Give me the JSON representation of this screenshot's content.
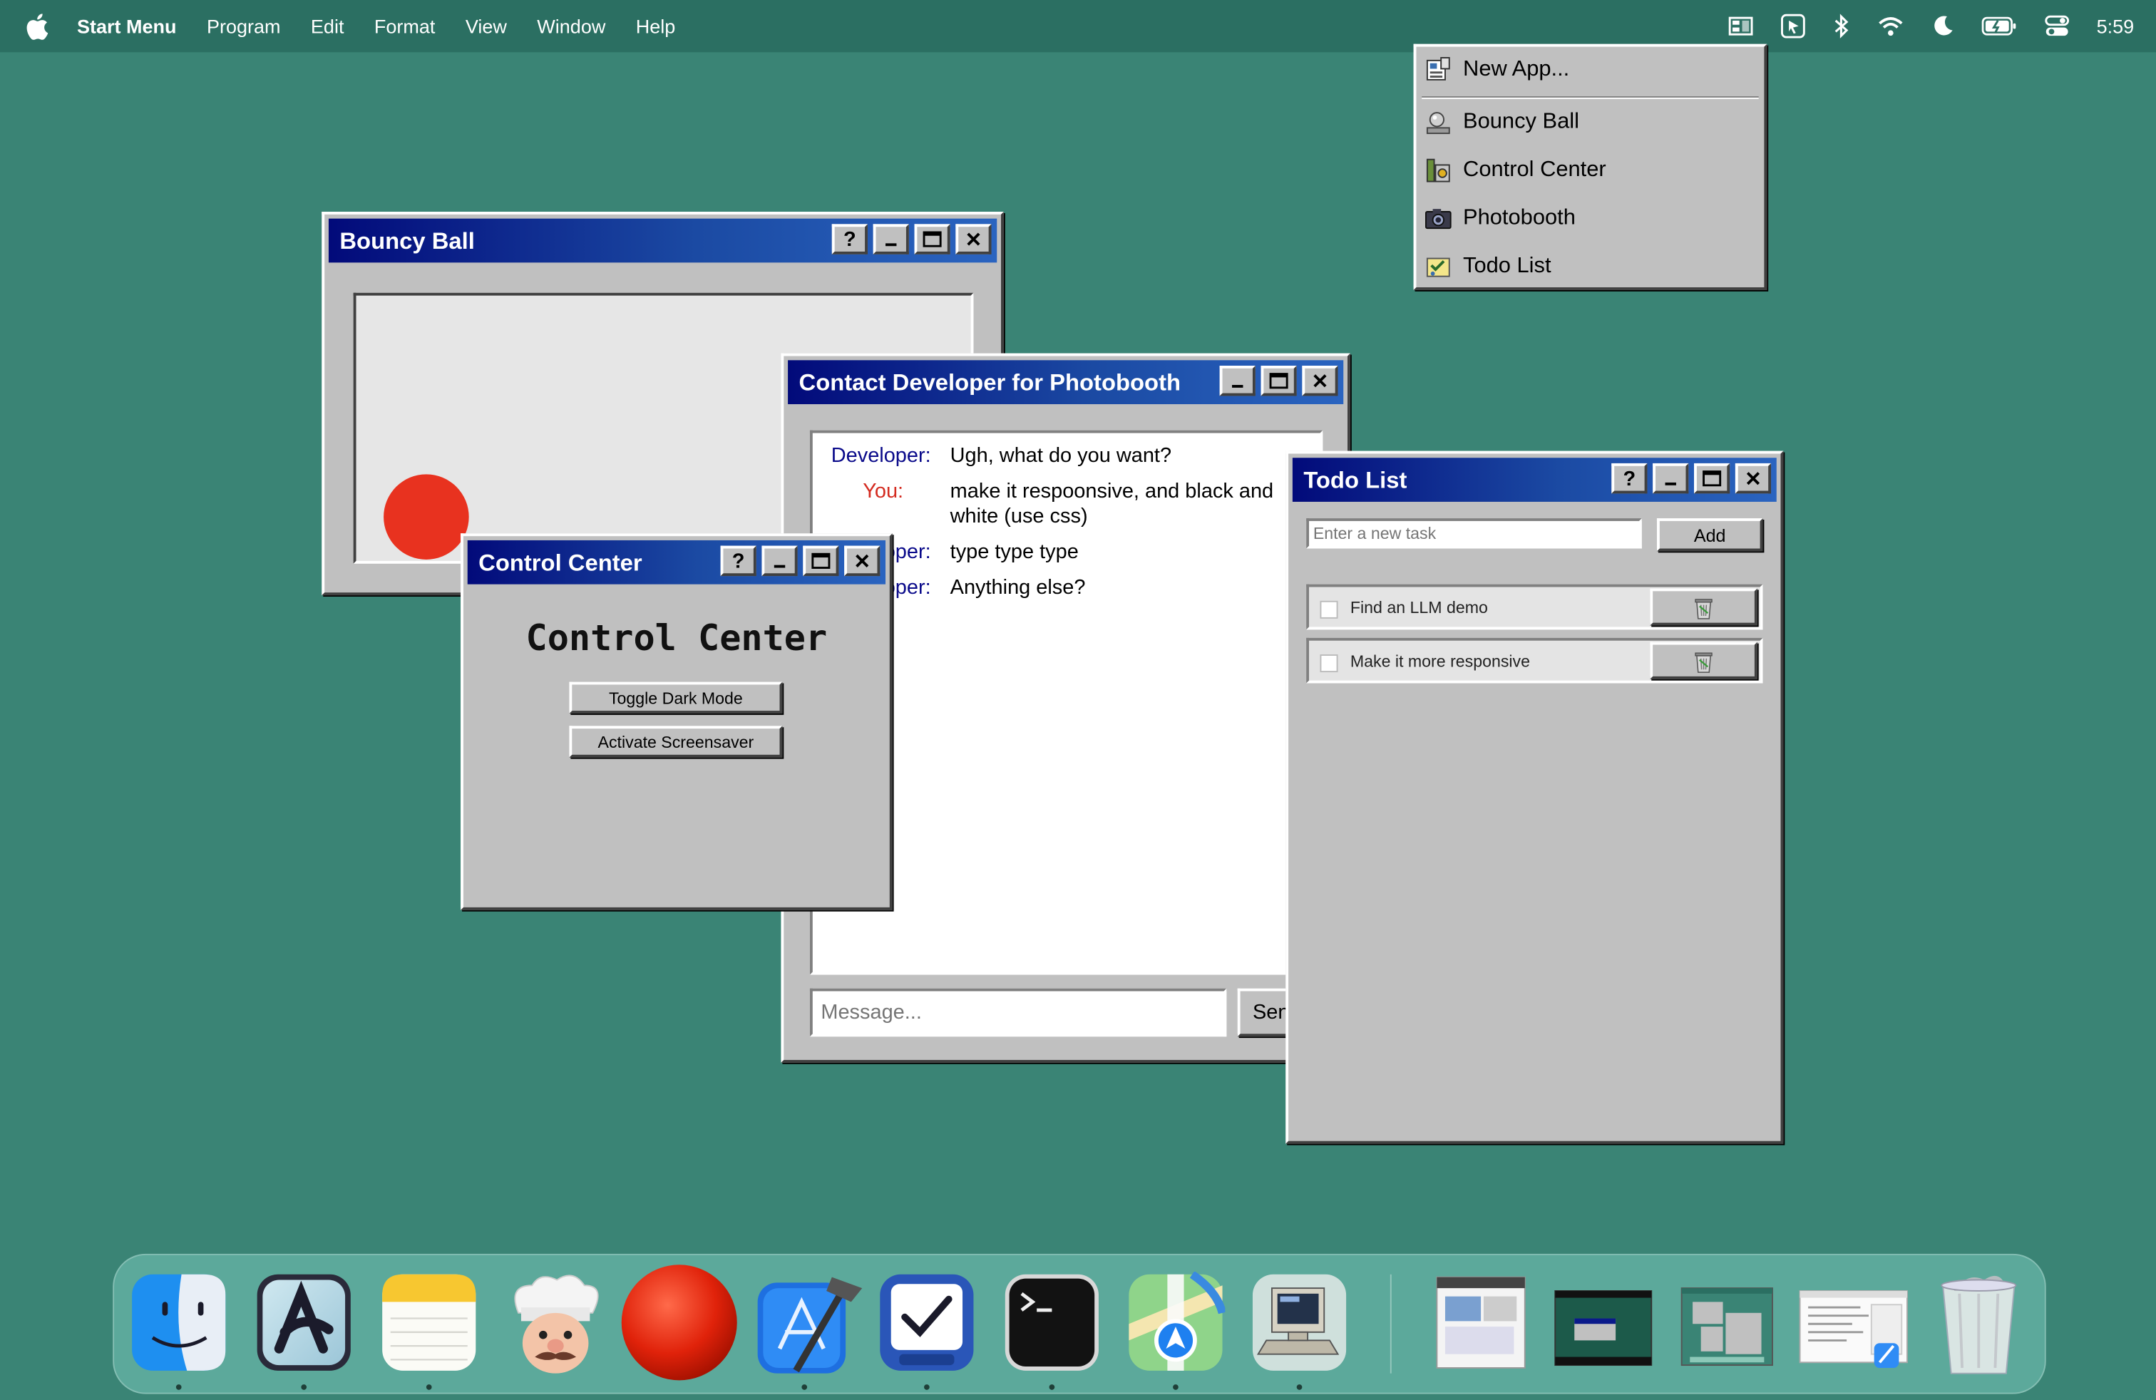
{
  "menubar": {
    "app_name": "Start Menu",
    "items": [
      "Program",
      "Edit",
      "Format",
      "View",
      "Window",
      "Help"
    ],
    "clock": "5:59"
  },
  "start_menu": {
    "items": [
      {
        "label": "New App...",
        "icon": "new-app-icon"
      },
      {
        "label": "Bouncy Ball",
        "icon": "bouncy-ball-icon"
      },
      {
        "label": "Control Center",
        "icon": "control-center-icon"
      },
      {
        "label": "Photobooth",
        "icon": "camera-icon"
      },
      {
        "label": "Todo List",
        "icon": "todo-icon"
      }
    ]
  },
  "bouncy_ball": {
    "title": "Bouncy Ball",
    "ball_color": "#e8321f"
  },
  "contact": {
    "title": "Contact Developer for Photobooth",
    "messages": [
      {
        "sender": "Developer:",
        "text": "Ugh, what do you want?"
      },
      {
        "sender": "You:",
        "text": "make it respoonsive, and black and white (use css)"
      },
      {
        "sender": "Developer:",
        "text": "type type type"
      },
      {
        "sender": "Developer:",
        "text": "Anything else?"
      }
    ],
    "input_placeholder": "Message...",
    "send_label": "Send"
  },
  "control_center": {
    "title": "Control Center",
    "heading": "Control Center",
    "buttons": [
      "Toggle Dark Mode",
      "Activate Screensaver"
    ]
  },
  "todo": {
    "title": "Todo List",
    "input_placeholder": "Enter a new task",
    "add_label": "Add",
    "items": [
      "Find an LLM demo",
      "Make it more responsive"
    ]
  },
  "dock": {
    "apps": [
      "finder",
      "arc",
      "notes",
      "chef",
      "red-ball",
      "xcode",
      "tasks",
      "terminal",
      "maps",
      "classic-mac"
    ]
  },
  "colors": {
    "desktop": "#3a8475",
    "title_start": "#020a7a",
    "title_end": "#2a64c0"
  }
}
